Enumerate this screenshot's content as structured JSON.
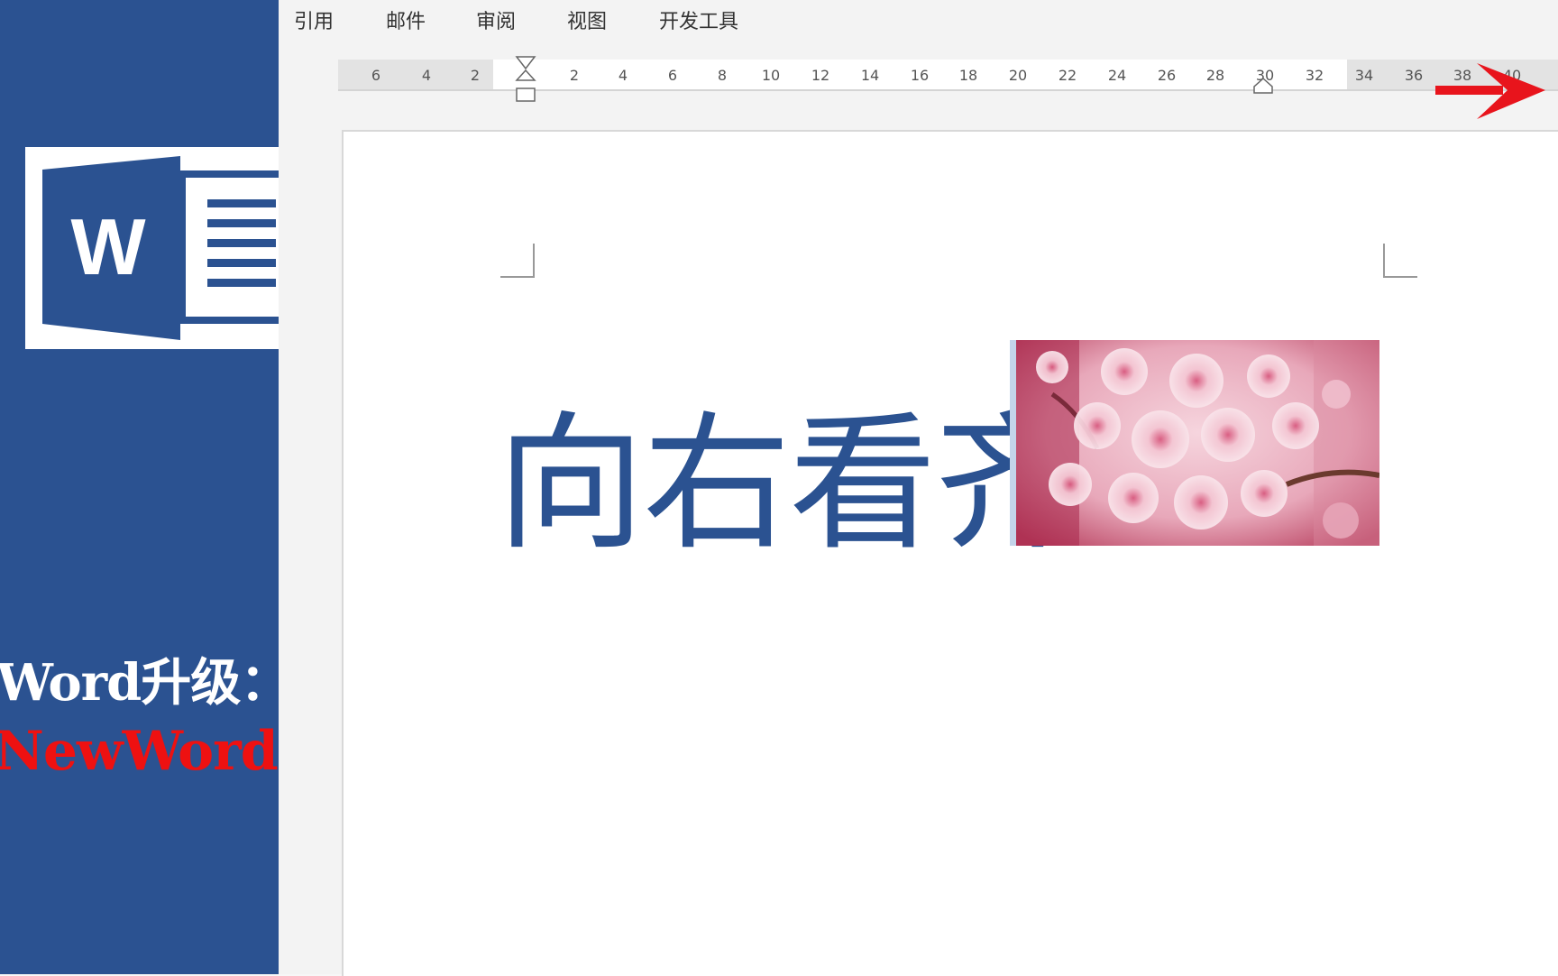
{
  "sidebar": {
    "logo_letter": "W",
    "promo_line1": "Word升级：",
    "promo_line2": "NewWord"
  },
  "ribbon": {
    "tabs": [
      {
        "label": "引用"
      },
      {
        "label": "邮件"
      },
      {
        "label": "审阅"
      },
      {
        "label": "视图"
      },
      {
        "label": "开发工具"
      }
    ]
  },
  "ruler": {
    "ticks": [
      "6",
      "4",
      "2",
      "2",
      "4",
      "6",
      "8",
      "10",
      "12",
      "14",
      "16",
      "18",
      "20",
      "22",
      "24",
      "26",
      "28",
      "30",
      "32",
      "34",
      "36",
      "38",
      "40"
    ]
  },
  "document": {
    "heading_text": "向右看齐",
    "picture_icon": "cherry-blossom-photo"
  },
  "colors": {
    "brand_blue": "#2b5291",
    "accent_red": "#ee1111",
    "arrow_red": "#e8141c"
  }
}
